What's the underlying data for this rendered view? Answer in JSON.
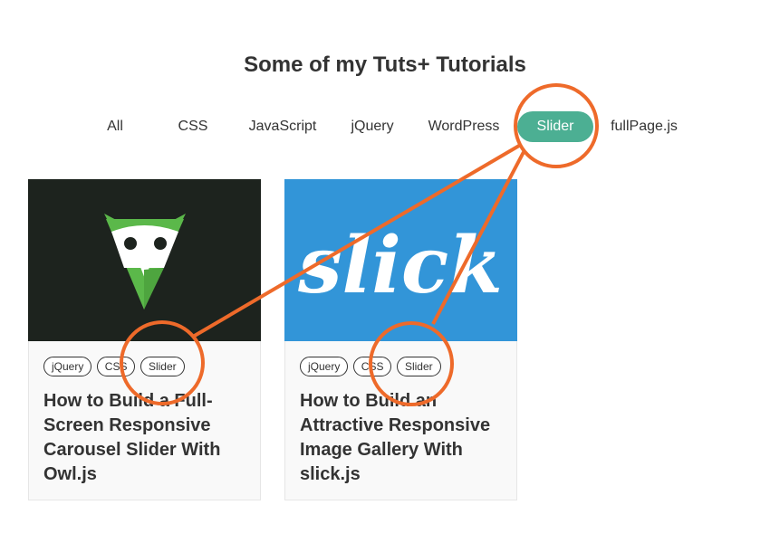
{
  "page": {
    "title": "Some of my Tuts+ Tutorials"
  },
  "filters": [
    {
      "label": "All"
    },
    {
      "label": "CSS"
    },
    {
      "label": "JavaScript"
    },
    {
      "label": "jQuery"
    },
    {
      "label": "WordPress"
    },
    {
      "label": "Slider",
      "active": true
    },
    {
      "label": "fullPage.js"
    }
  ],
  "cards": [
    {
      "image_icon": "owl-logo",
      "tags": [
        "jQuery",
        "CSS",
        "Slider"
      ],
      "title": "How to Build a Full-Screen Responsive Carousel Slider With Owl.js"
    },
    {
      "image_icon": "slick-logo",
      "image_text": "slick",
      "tags": [
        "jQuery",
        "CSS",
        "Slider"
      ],
      "title": "How to Build an Attractive Responsive Image Gallery With slick.js"
    }
  ],
  "colors": {
    "accent": "#4caf93",
    "annotation": "#ee6a2a",
    "owl_bg": "#1d231e",
    "owl_green": "#5bb84a",
    "slick_bg": "#3295d8"
  }
}
